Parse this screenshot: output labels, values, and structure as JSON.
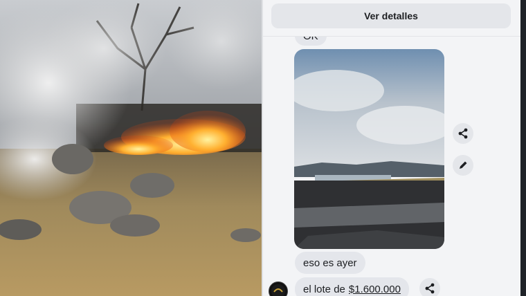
{
  "chat": {
    "details_button": "Ver detalles",
    "messages": [
      {
        "text": "OK"
      },
      {
        "text": "eso es ayer"
      },
      {
        "text_prefix": "el lote de",
        "amount": "$1.600.000"
      }
    ],
    "actions": {
      "share_icon": "share-icon",
      "edit_icon": "pencil-icon"
    }
  },
  "colors": {
    "bubble": "#e4e6eb",
    "chat_background": "#f3f4f6",
    "fire": "#ff7a10"
  }
}
